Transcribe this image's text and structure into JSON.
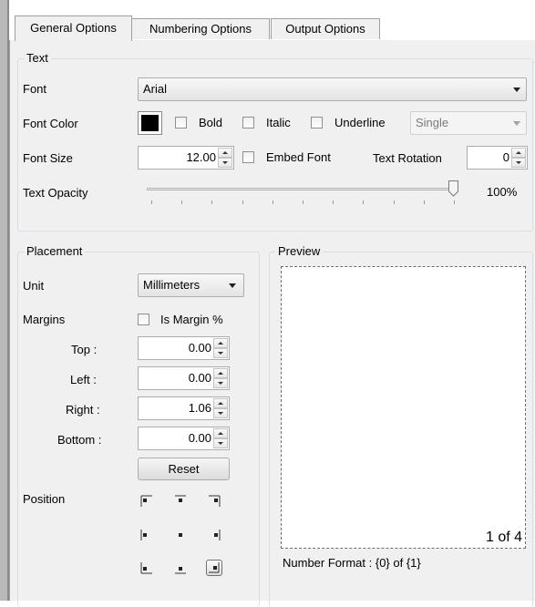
{
  "tabs": [
    {
      "label": "General Options",
      "active": true
    },
    {
      "label": "Numbering Options",
      "active": false
    },
    {
      "label": "Output Options",
      "active": false
    }
  ],
  "text_group": {
    "title": "Text",
    "font_label": "Font",
    "font_value": "Arial",
    "font_color_label": "Font Color",
    "font_color": "#000000",
    "bold_label": "Bold",
    "italic_label": "Italic",
    "underline_label": "Underline",
    "underline_style": "Single",
    "font_size_label": "Font Size",
    "font_size_value": "12.00",
    "embed_font_label": "Embed Font",
    "text_rotation_label": "Text Rotation",
    "text_rotation_value": "0",
    "text_opacity_label": "Text Opacity",
    "text_opacity_value": "100%",
    "text_opacity_fraction": 1.0
  },
  "placement_group": {
    "title": "Placement",
    "unit_label": "Unit",
    "unit_value": "Millimeters",
    "margins_label": "Margins",
    "is_margin_percent_label": "Is Margin %",
    "top_label": "Top :",
    "top_value": "0.00",
    "left_label": "Left :",
    "left_value": "0.00",
    "right_label": "Right :",
    "right_value": "1.06",
    "bottom_label": "Bottom :",
    "bottom_value": "0.00",
    "reset_label": "Reset",
    "position_label": "Position",
    "position_selected": "bottom-right"
  },
  "preview_group": {
    "title": "Preview",
    "sample_text": "1 of 4",
    "number_format": "Number Format : {0} of {1}"
  }
}
